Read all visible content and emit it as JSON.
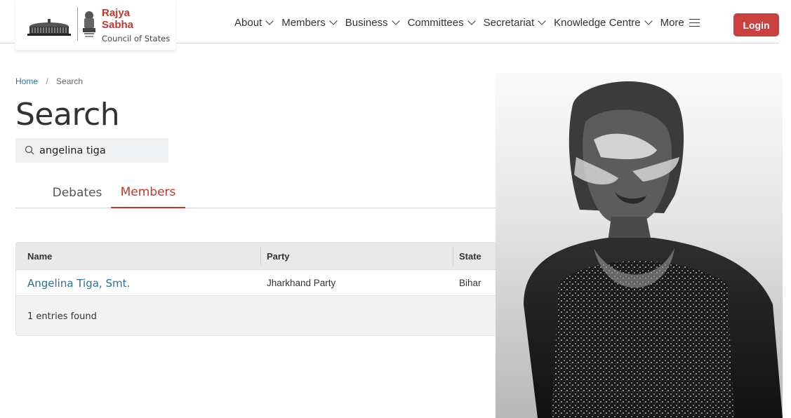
{
  "header": {
    "brand_line1": "Rajya",
    "brand_line2": "Sabha",
    "brand_sub": "Council of States",
    "nav": [
      {
        "label": "About"
      },
      {
        "label": "Members"
      },
      {
        "label": "Business"
      },
      {
        "label": "Committees"
      },
      {
        "label": "Secretariat"
      },
      {
        "label": "Knowledge Centre"
      }
    ],
    "more_label": "More",
    "login_label": "Login",
    "brand_color": "#c0392b",
    "login_color": "#c9403e"
  },
  "breadcrumb": {
    "home": "Home",
    "separator": "/",
    "current": "Search"
  },
  "page": {
    "title": "Search"
  },
  "search": {
    "value": "angelina tiga"
  },
  "tabs": {
    "debates": "Debates",
    "members": "Members",
    "active": "Members"
  },
  "table": {
    "columns": [
      "Name",
      "Party",
      "State"
    ],
    "rows": [
      {
        "name": "Angelina Tiga, Smt.",
        "party": "Jharkhand Party",
        "state": "Bihar"
      }
    ],
    "footer": "1 entries found"
  },
  "colors": {
    "link": "#2a6f97",
    "accent": "#c0392b"
  },
  "photo": {
    "description_icon": "member-portrait"
  }
}
